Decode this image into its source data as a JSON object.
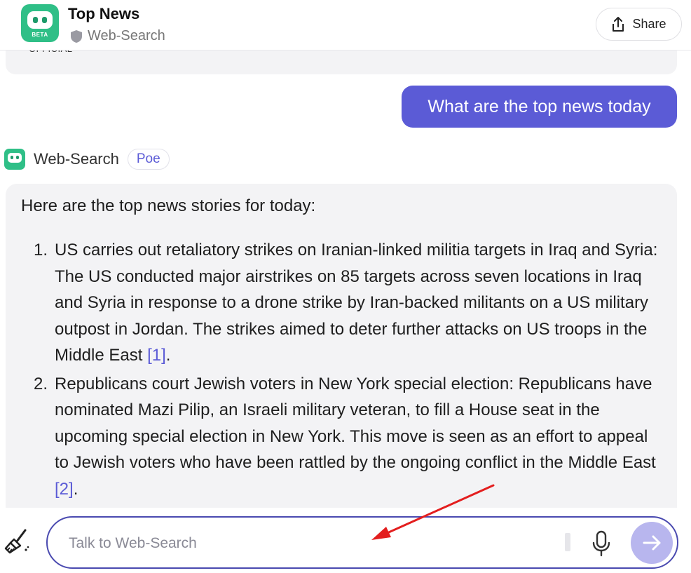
{
  "header": {
    "title": "Top News",
    "subtitle": "Web-Search",
    "avatar_badge": "BETA",
    "share_label": "Share"
  },
  "previous_message": {
    "partial_text": "OFFICIAL"
  },
  "user_message": "What are the top news today",
  "bot": {
    "name": "Web-Search",
    "badge": "Poe"
  },
  "answer": {
    "intro": "Here are the top news stories for today:",
    "items": [
      {
        "num": "1.",
        "text": "US carries out retaliatory strikes on Iranian-linked militia targets in Iraq and Syria: The US conducted major airstrikes on 85 targets across seven locations in Iraq and Syria in response to a drone strike by Iran-backed militants on a US military outpost in Jordan. The strikes aimed to deter further attacks on US troops in the Middle East",
        "cite": "[1]"
      },
      {
        "num": "2.",
        "text": "Republicans court Jewish voters in New York special election: Republicans have nominated Mazi Pilip, an Israeli military veteran, to fill a House seat in the upcoming special election in New York. This move is seen as an effort to appeal to Jewish voters who have been rattled by the ongoing conflict in the Middle East",
        "cite": "[2]"
      },
      {
        "num": "3.",
        "text": "",
        "cite": ""
      }
    ]
  },
  "composer": {
    "placeholder": "Talk to Web-Search",
    "value": ""
  },
  "icons": {
    "share": "share-icon",
    "shield": "shield-icon",
    "broom": "broom-icon",
    "mic": "microphone-icon",
    "send": "send-arrow-icon"
  },
  "colors": {
    "accent": "#5b5bd6",
    "bot_green": "#2fbf87",
    "send_disabled": "#b8b6ee",
    "annotation_arrow": "#e31e1e"
  }
}
